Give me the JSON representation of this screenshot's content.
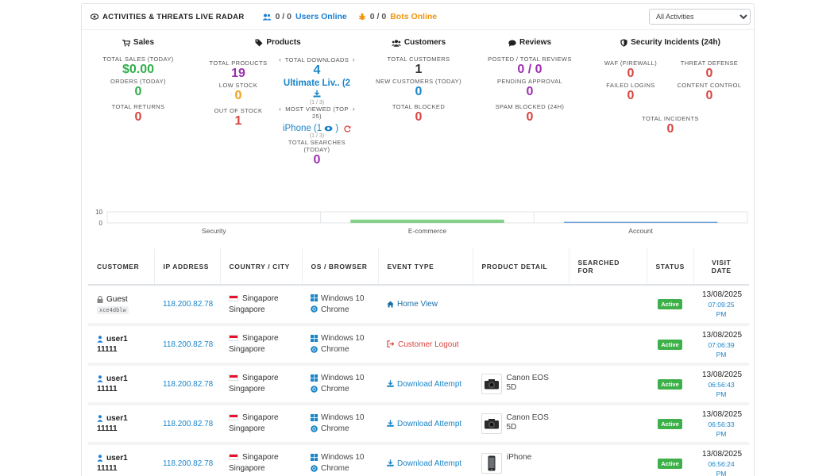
{
  "header": {
    "title": "ACTIVITIES & THREATS LIVE RADAR",
    "users_count": "0 / 0",
    "users_label": "Users Online",
    "bots_count": "0 / 0",
    "bots_label": "Bots Online",
    "filter_selected": "All Activities"
  },
  "sales": {
    "heading": "Sales",
    "total_sales_label": "TOTAL SALES (TODAY)",
    "total_sales_value": "$0.00",
    "orders_label": "ORDERS (TODAY)",
    "orders_value": "0",
    "returns_label": "TOTAL RETURNS",
    "returns_value": "0"
  },
  "products": {
    "heading": "Products",
    "total_products_label": "TOTAL PRODUCTS",
    "total_products_value": "19",
    "low_stock_label": "LOW STOCK",
    "low_stock_value": "0",
    "out_of_stock_label": "OUT OF STOCK",
    "out_of_stock_value": "1",
    "total_downloads_label": "TOTAL DOWNLOADS",
    "total_downloads_value": "4",
    "top_download_name": "Ultimate Liv.. (2",
    "top_download_pager": "(1 / 3)",
    "most_viewed_label": "MOST VIEWED (TOP",
    "most_viewed_label2": "25)",
    "most_viewed_name": "iPhone (1",
    "most_viewed_pager": "(1 / 3)",
    "total_searches_label": "TOTAL SEARCHES",
    "total_searches_label2": "(TODAY)",
    "total_searches_value": "0"
  },
  "customers": {
    "heading": "Customers",
    "total_customers_label": "TOTAL CUSTOMERS",
    "total_customers_value": "1",
    "new_customers_label": "NEW CUSTOMERS (TODAY)",
    "new_customers_value": "0",
    "total_blocked_label": "TOTAL BLOCKED",
    "total_blocked_value": "0"
  },
  "reviews": {
    "heading": "Reviews",
    "posted_label": "POSTED / TOTAL REVIEWS",
    "posted_value": "0 / 0",
    "pending_label": "PENDING APPROVAL",
    "pending_value": "0",
    "spam_label": "SPAM BLOCKED (24H)",
    "spam_value": "0"
  },
  "security": {
    "heading": "Security Incidents (24h)",
    "waf_label": "WAF (FIREWALL)",
    "waf_value": "0",
    "threat_label": "THREAT DEFENSE",
    "threat_value": "0",
    "failed_label": "FAILED LOGINS",
    "failed_value": "0",
    "content_label": "CONTENT CONTROL",
    "content_value": "0",
    "total_label": "TOTAL INCIDENTS",
    "total_value": "0"
  },
  "chart_data": {
    "type": "bar",
    "categories": [
      "Security",
      "E-commerce",
      "Account"
    ],
    "series": [
      {
        "values": [
          0,
          3,
          1
        ],
        "color": "#86d18a"
      }
    ],
    "bar_colors": [
      "#86d18a",
      "#86d18a",
      "#6fa0d4"
    ],
    "yticks": [
      "10",
      "0"
    ],
    "ylim": [
      0,
      10
    ]
  },
  "table": {
    "headers": [
      "CUSTOMER",
      "IP ADDRESS",
      "COUNTRY / CITY",
      "OS / BROWSER",
      "EVENT TYPE",
      "PRODUCT DETAIL",
      "SEARCHED FOR",
      "STATUS",
      "VISIT",
      "DATE"
    ],
    "rows": [
      {
        "customer": "Guest",
        "session": "xce4dblw",
        "ip": "118.200.82.78",
        "country": "Singapore",
        "city": "Singapore",
        "os": "Windows 10",
        "browser": "Chrome",
        "event": "Home View",
        "event_type": "home",
        "product": "",
        "product_icon": "",
        "searched": "",
        "status": "Active",
        "date": "13/08/2025",
        "time": "07:09:25 PM"
      },
      {
        "customer": "user1",
        "customer2": "11111",
        "ip": "118.200.82.78",
        "country": "Singapore",
        "city": "Singapore",
        "os": "Windows 10",
        "browser": "Chrome",
        "event": "Customer Logout",
        "event_type": "logout",
        "product": "",
        "product_icon": "",
        "searched": "",
        "status": "Active",
        "date": "13/08/2025",
        "time": "07:06:39 PM"
      },
      {
        "customer": "user1",
        "customer2": "11111",
        "ip": "118.200.82.78",
        "country": "Singapore",
        "city": "Singapore",
        "os": "Windows 10",
        "browser": "Chrome",
        "event": "Download Attempt",
        "event_type": "download",
        "product": "Canon EOS 5D",
        "product_icon": "camera-icon",
        "searched": "",
        "status": "Active",
        "date": "13/08/2025",
        "time": "06:56:43 PM"
      },
      {
        "customer": "user1",
        "customer2": "11111",
        "ip": "118.200.82.78",
        "country": "Singapore",
        "city": "Singapore",
        "os": "Windows 10",
        "browser": "Chrome",
        "event": "Download Attempt",
        "event_type": "download",
        "product": "Canon EOS 5D",
        "product_icon": "camera-icon",
        "searched": "",
        "status": "Active",
        "date": "13/08/2025",
        "time": "06:56:33 PM"
      },
      {
        "customer": "user1",
        "customer2": "11111",
        "ip": "118.200.82.78",
        "country": "Singapore",
        "city": "Singapore",
        "os": "Windows 10",
        "browser": "Chrome",
        "event": "Download Attempt",
        "event_type": "download",
        "product": "iPhone",
        "product_icon": "phone-icon",
        "searched": "",
        "status": "Active",
        "date": "13/08/2025",
        "time": "06:56:24 PM"
      }
    ]
  }
}
